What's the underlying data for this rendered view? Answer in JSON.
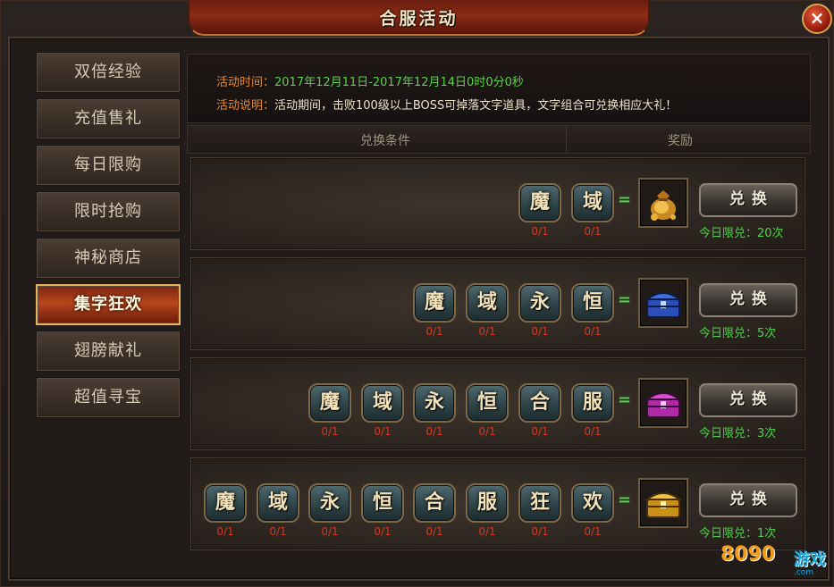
{
  "window": {
    "title": "合服活动",
    "close_icon": "×"
  },
  "sidebar": {
    "items": [
      {
        "label": "双倍经验",
        "active": false
      },
      {
        "label": "充值售礼",
        "active": false
      },
      {
        "label": "每日限购",
        "active": false
      },
      {
        "label": "限时抢购",
        "active": false
      },
      {
        "label": "神秘商店",
        "active": false
      },
      {
        "label": "集字狂欢",
        "active": true
      },
      {
        "label": "翅膀献礼",
        "active": false
      },
      {
        "label": "超值寻宝",
        "active": false
      }
    ]
  },
  "info": {
    "time_label": "活动时间：",
    "time_value": "2017年12月11日-2017年12月14日0时0分0秒",
    "desc_label": "活动说明：",
    "desc_value": "活动期间，击败100级以上BOSS可掉落文字道具，文字组合可兑换相应大礼！"
  },
  "table": {
    "col_condition": "兑换条件",
    "col_reward": "奖励"
  },
  "rows": [
    {
      "chars": [
        {
          "c": "魔",
          "count": "0/1"
        },
        {
          "c": "域",
          "count": "0/1"
        }
      ],
      "equals": "=",
      "reward_icon": "money-bag-icon",
      "button": "兑换",
      "limit": "今日限兑：20次"
    },
    {
      "chars": [
        {
          "c": "魔",
          "count": "0/1"
        },
        {
          "c": "域",
          "count": "0/1"
        },
        {
          "c": "永",
          "count": "0/1"
        },
        {
          "c": "恒",
          "count": "0/1"
        }
      ],
      "equals": "=",
      "reward_icon": "blue-chest-icon",
      "button": "兑换",
      "limit": "今日限兑：5次"
    },
    {
      "chars": [
        {
          "c": "魔",
          "count": "0/1"
        },
        {
          "c": "域",
          "count": "0/1"
        },
        {
          "c": "永",
          "count": "0/1"
        },
        {
          "c": "恒",
          "count": "0/1"
        },
        {
          "c": "合",
          "count": "0/1"
        },
        {
          "c": "服",
          "count": "0/1"
        }
      ],
      "equals": "=",
      "reward_icon": "purple-chest-icon",
      "button": "兑换",
      "limit": "今日限兑：3次"
    },
    {
      "chars": [
        {
          "c": "魔",
          "count": "0/1"
        },
        {
          "c": "域",
          "count": "0/1"
        },
        {
          "c": "永",
          "count": "0/1"
        },
        {
          "c": "恒",
          "count": "0/1"
        },
        {
          "c": "合",
          "count": "0/1"
        },
        {
          "c": "服",
          "count": "0/1"
        },
        {
          "c": "狂",
          "count": "0/1"
        },
        {
          "c": "欢",
          "count": "0/1"
        }
      ],
      "equals": "=",
      "reward_icon": "gold-chest-icon",
      "button": "兑换",
      "limit": "今日限兑：1次"
    }
  ],
  "watermark": {
    "brand": "8090",
    "name": "游戏",
    "domain": ".com"
  },
  "colors": {
    "accent_green": "#4fd14a",
    "count_red": "#d23b22",
    "label_orange": "#e08a3c",
    "active_tab": "#b8461c"
  }
}
